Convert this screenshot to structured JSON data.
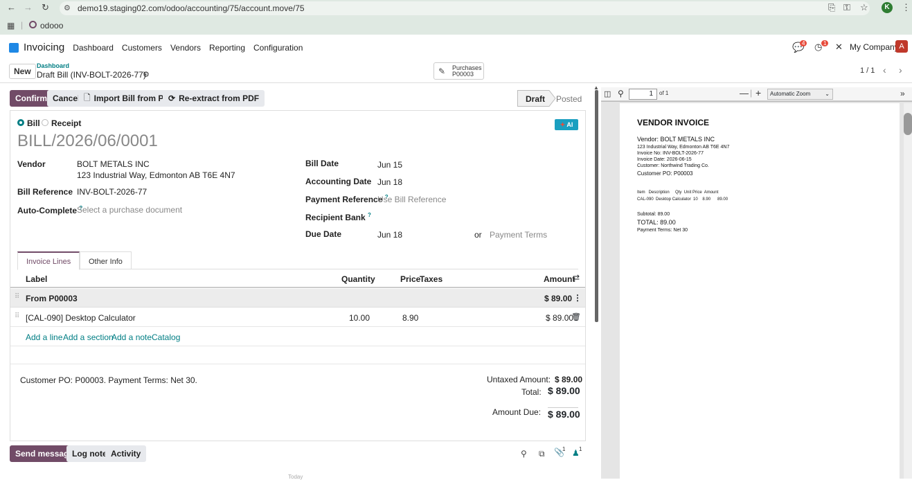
{
  "browser": {
    "url": "demo19.staging02.com/odoo/accounting/75/account.move/75",
    "bookmark": "odooo",
    "profile_initial": "K"
  },
  "nav": {
    "app": "Invoicing",
    "menu": [
      "Dashboard",
      "Customers",
      "Vendors",
      "Reporting",
      "Configuration"
    ],
    "messages_count": "4",
    "activities_count": "1",
    "company": "My Company",
    "user_initial": "A"
  },
  "control": {
    "new_label": "New",
    "breadcrumb_parent": "Dashboard",
    "record_title": "Draft Bill (INV-BOLT-2026-77)",
    "smart_button_label": "Purchases",
    "smart_button_value": "P00003",
    "pager": "1 / 1"
  },
  "actions": {
    "confirm": "Confirm",
    "cancel": "Cancel",
    "import_pdf": "Import Bill from PDF",
    "reextract_pdf": "Re-extract from PDF",
    "status_draft": "Draft",
    "status_posted": "Posted"
  },
  "form": {
    "type_bill": "Bill",
    "type_receipt": "Receipt",
    "ai_badge": "AI",
    "name": "BILL/2026/06/0001",
    "vendor_label": "Vendor",
    "vendor_name": "BOLT METALS INC",
    "vendor_address": "123 Industrial Way, Edmonton AB T6E 4N7",
    "bill_ref_label": "Bill Reference",
    "bill_ref": "INV-BOLT-2026-77",
    "autocomplete_label": "Auto-Complete",
    "autocomplete_placeholder": "Select a purchase document",
    "bill_date_label": "Bill Date",
    "bill_date": "Jun 15",
    "accounting_date_label": "Accounting Date",
    "accounting_date": "Jun 18",
    "payment_ref_label": "Payment Reference",
    "payment_ref_placeholder": "Use Bill Reference",
    "recipient_bank_label": "Recipient Bank",
    "due_date_label": "Due Date",
    "due_date": "Jun 18",
    "or_text": "or",
    "payment_terms_placeholder": "Payment Terms",
    "help_mark": "?"
  },
  "tabs": [
    "Invoice Lines",
    "Other Info"
  ],
  "lines": {
    "headers": {
      "label": "Label",
      "quantity": "Quantity",
      "price": "Price",
      "taxes": "Taxes",
      "amount": "Amount"
    },
    "section": {
      "label": "From P00003",
      "amount": "$ 89.00"
    },
    "items": [
      {
        "label": "[CAL-090] Desktop Calculator",
        "quantity": "10.00",
        "price": "8.90",
        "amount": "$ 89.00"
      }
    ],
    "add_line": "Add a line",
    "add_section": "Add a section",
    "add_note": "Add a note",
    "catalog": "Catalog"
  },
  "totals": {
    "note": "Customer PO: P00003. Payment Terms: Net 30.",
    "untaxed_label": "Untaxed Amount:",
    "untaxed": "$ 89.00",
    "total_label": "Total:",
    "total": "$ 89.00",
    "due_label": "Amount Due:",
    "due": "$ 89.00"
  },
  "chatter": {
    "send_message": "Send message",
    "log_note": "Log note",
    "activity": "Activity",
    "attachments_count": "1",
    "followers_count": "1",
    "today": "Today"
  },
  "pdf": {
    "page_input": "1",
    "page_of": "of 1",
    "zoom": "Automatic Zoom",
    "title": "VENDOR INVOICE",
    "vendor_line": "Vendor: BOLT METALS INC",
    "address": "123 Industrial Way, Edmonton AB T6E 4N7",
    "invoice_no": "Invoice No: INV-BOLT-2026-77",
    "invoice_date": "Invoice Date: 2026-06-15",
    "customer": "Customer: Northwind Trading Co.",
    "customer_po": "Customer PO: P00003",
    "table_header": "Item   Description     Qty  Unit Price  Amount",
    "table_row": "CAL-090  Desktop Calculator  10    8.90      89.00",
    "subtotal": "Subtotal: 89.00",
    "total": "TOTAL: 89.00",
    "terms": "Payment Terms: Net 30"
  },
  "colors": {
    "brand": "#714b67",
    "teal": "#017e84",
    "badge_red": "#e74c3c"
  }
}
